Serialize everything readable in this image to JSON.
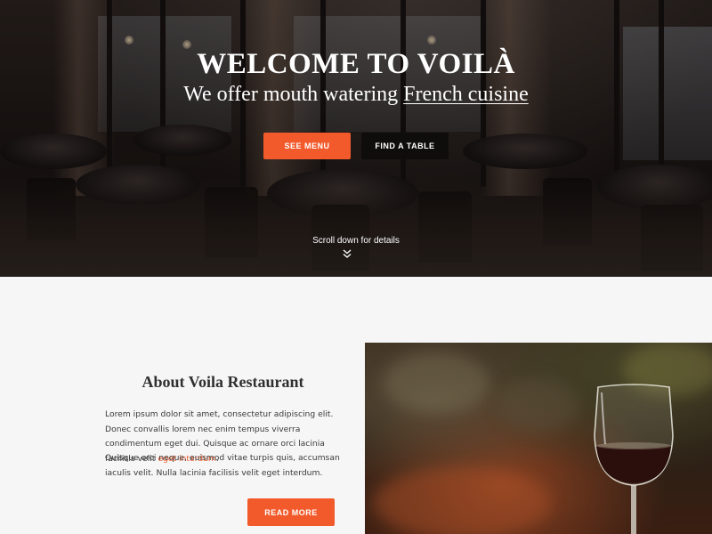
{
  "hero": {
    "title": "WELCOME TO VOILÀ",
    "subtitle_pre": "We offer mouth watering ",
    "subtitle_highlight": "French cuisine",
    "see_menu_label": "SEE MENU",
    "find_table_label": "FIND A TABLE",
    "scroll_hint": "Scroll down for details",
    "scroll_icon": "chevron-double-down-icon"
  },
  "about": {
    "heading": "About Voila Restaurant",
    "paragraph1_text": "Lorem ipsum dolor sit amet, consectetur adipiscing elit. Donec convallis lorem nec enim tempus viverra condimentum eget dui. Quisque ac ornare orci lacinia facilisis velit ",
    "paragraph1_link": "eget interdum",
    "paragraph1_end": ".",
    "paragraph2": "Quisque orci neque, euismod vitae turpis quis, accumsan iaculis velit. Nulla lacinia facilisis velit eget interdum.",
    "read_more_label": "READ MORE"
  },
  "colors": {
    "accent": "#f25a2b",
    "dark_button": "#0f0d0c",
    "section_bg": "#f6f6f6",
    "heading_text": "#2f2f2f"
  }
}
